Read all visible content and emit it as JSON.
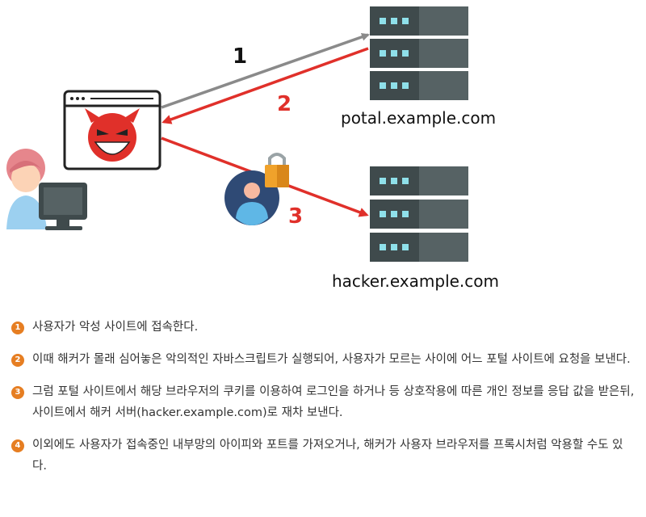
{
  "diagram": {
    "arrow_numbers": [
      "1",
      "2",
      "3"
    ],
    "servers": {
      "portal": {
        "label": "potal.example.com"
      },
      "hacker": {
        "label": "hacker.example.com"
      }
    }
  },
  "steps": [
    {
      "num": "1",
      "text": "사용자가 악성 사이트에 접속한다."
    },
    {
      "num": "2",
      "text": "이때 해커가 몰래 심어놓은 악의적인 자바스크립트가 실행되어, 사용자가 모르는 사이에 어느 포털 사이트에 요청을 보낸다."
    },
    {
      "num": "3",
      "text": "그럼 포털 사이트에서 해당 브라우저의 쿠키를 이용하여 로그인을 하거나 등 상호작용에 따른 개인 정보를 응답 값을 받은뒤, 사이트에서 해커 서버(hacker.example.com)로 재차 보낸다."
    },
    {
      "num": "4",
      "text": "이외에도 사용자가 접속중인 내부망의 아이피와 포트를 가져오거나, 해커가 사용자 브라우저를 프록시처럼 악용할 수도 있다."
    }
  ]
}
